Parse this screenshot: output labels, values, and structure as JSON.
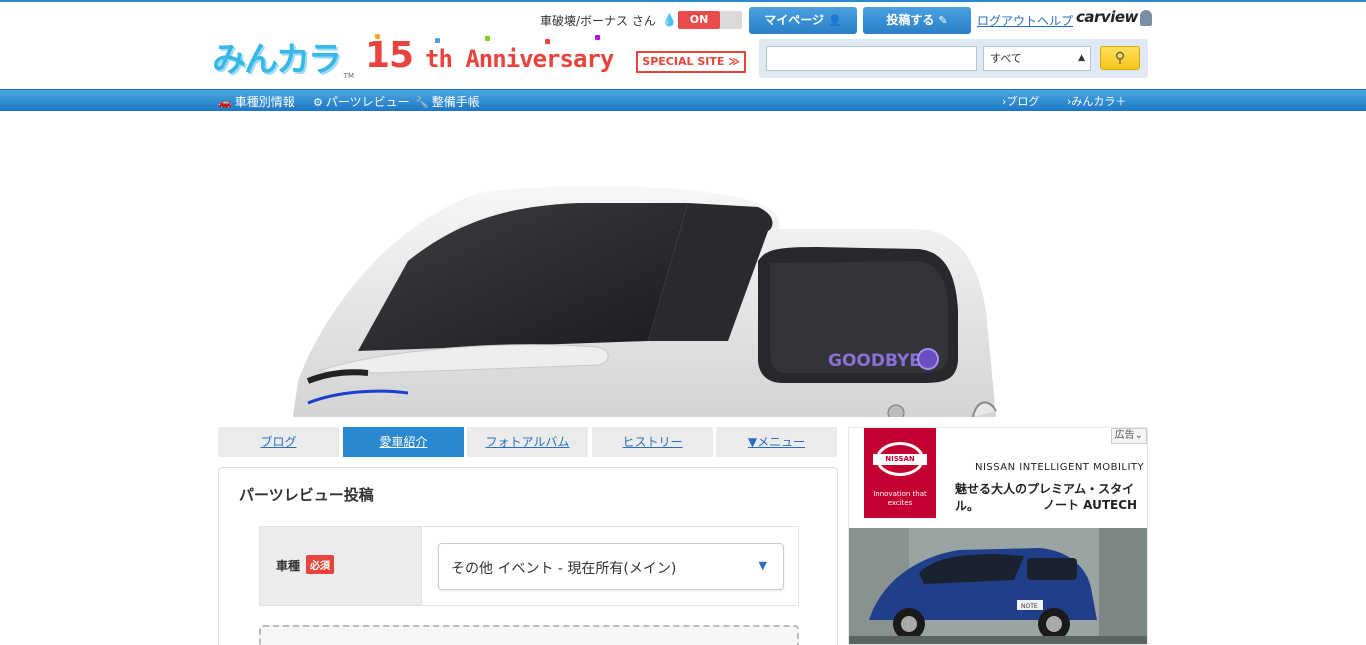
{
  "header": {
    "user_name": "車破壊/ボーナス さん",
    "toggle_label": "ON",
    "mypage_label": "マイページ",
    "post_label": "投稿する",
    "logout_label": "ログアウト",
    "help_label": "ヘルプ",
    "carview_label": "carview",
    "logo_text": "みんカラ",
    "logo_tm": "TM",
    "anniversary_number": "15",
    "anniversary_word": "th Anniversary",
    "special_site_label": "SPECIAL SITE ≫"
  },
  "search": {
    "placeholder": "",
    "category_value": "すべて",
    "search_icon": "search-icon"
  },
  "nav": {
    "car_info": "車種別情報",
    "parts_review": "パーツレビュー",
    "maintenance": "整備手帳",
    "blog": "ブログ",
    "minkara_plus": "みんカラ＋"
  },
  "hero": {
    "goodbye_text": "GOODBYE!"
  },
  "tabs": [
    {
      "label": "ブログ",
      "active": false
    },
    {
      "label": "愛車紹介",
      "active": true
    },
    {
      "label": "フォトアルバム",
      "active": false
    },
    {
      "label": "ヒストリー",
      "active": false
    },
    {
      "label": "▼メニュー",
      "active": false
    }
  ],
  "form": {
    "title": "パーツレビュー投稿",
    "car_label": "車種",
    "required_badge": "必須",
    "car_value": "その他 イベント - 現在所有(メイン)"
  },
  "ad": {
    "label": "広告",
    "brand": "NISSAN",
    "tagline": "Innovation that excites",
    "line1": "NISSAN INTELLIGENT MOBILITY",
    "line2": "魅せる大人のプレミアム・スタイル。",
    "line3": "ノート AUTECH",
    "plate": "NOTE"
  },
  "colors": {
    "accent_blue": "#2a88d0",
    "toggle_red": "#e94a4a",
    "search_yellow": "#f7c51b",
    "nissan_red": "#c3002f"
  }
}
